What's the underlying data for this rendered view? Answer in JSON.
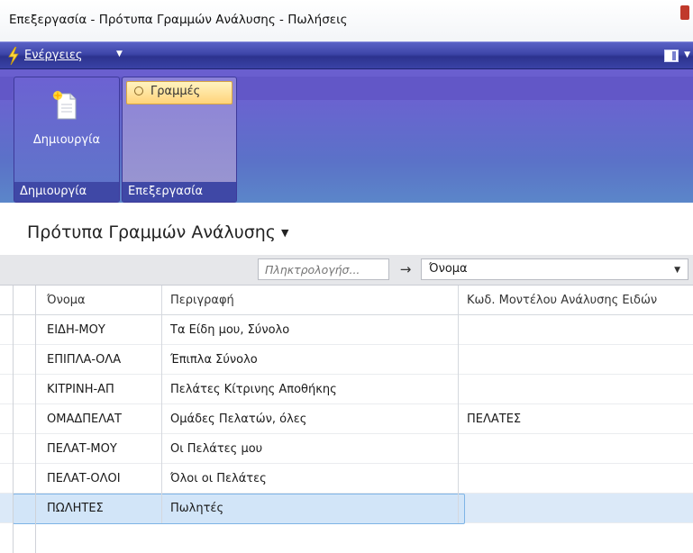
{
  "window": {
    "title": "Επεξεργασία - Πρότυπα Γραμμών Ανάλυσης - Πωλήσεις"
  },
  "actionbar": {
    "actions_label": "Ενέργειες"
  },
  "ribbon": {
    "new_button_label": "Δημιουργία",
    "create_group_label": "Δημιουργία",
    "lines_button_label": "Γραμμές",
    "edit_group_label": "Επεξεργασία"
  },
  "page": {
    "title": "Πρότυπα Γραμμών Ανάλυσης"
  },
  "filter": {
    "search_placeholder": "Πληκτρολογήσ...",
    "field_value": "Όνομα"
  },
  "grid": {
    "headers": [
      "Όνομα",
      "Περιγραφή",
      "Κωδ. Μοντέλου Ανάλυσης Ειδών"
    ],
    "rows": [
      [
        "ΕΙΔΗ-ΜΟΥ",
        "Τα Είδη μου, Σύνολο",
        ""
      ],
      [
        "ΕΠΙΠΛΑ-ΟΛΑ",
        "Έπιπλα Σύνολο",
        ""
      ],
      [
        "ΚΙΤΡΙΝΗ-ΑΠ",
        "Πελάτες Κίτρινης Αποθήκης",
        ""
      ],
      [
        "ΟΜΑΔΠΕΛΑΤ",
        "Ομάδες Πελατών, όλες",
        "ΠΕΛΑΤΕΣ"
      ],
      [
        "ΠΕΛΑΤ-ΜΟΥ",
        "Οι Πελάτες μου",
        ""
      ],
      [
        "ΠΕΛΑΤ-ΟΛΟΙ",
        "Όλοι οι Πελάτες",
        ""
      ],
      [
        "ΠΩΛΗΤΕΣ",
        "Πωλητές",
        ""
      ]
    ],
    "selected_row": 6
  },
  "colors": {
    "actionbar": "#3d45a8",
    "ribbon": "#6a5fcf",
    "group_label": "#3f48a6",
    "lines_button": "#ffd37a",
    "selection": "#d2e5f8"
  }
}
